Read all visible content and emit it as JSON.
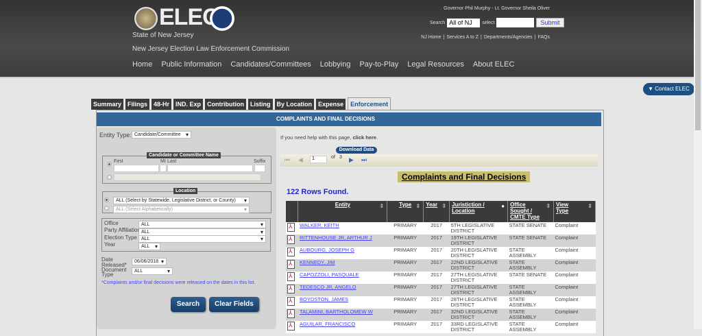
{
  "header": {
    "logo": "ELEC",
    "state": "State of New Jersey",
    "agency": "New Jersey Election Law Enforcement Commission",
    "governor": "Governor Phil Murphy - Lt. Governor Sheila Oliver",
    "search_label": "Search",
    "search_scope": "All of NJ",
    "select_label": "select",
    "submit": "Submit",
    "links": [
      "NJ Home",
      "Services A to Z",
      "Departments/Agencies",
      "FAQs"
    ],
    "nav": [
      "Home",
      "Public Information",
      "Candidates/Committees",
      "Lobbying",
      "Pay-to-Play",
      "Legal Resources",
      "About ELEC"
    ]
  },
  "contact": "▼ Contact ELEC",
  "tabs": [
    "Summary",
    "Filings",
    "48-Hr",
    "IND. Exp",
    "Contribution",
    "Listing",
    "By Location",
    "Expense",
    "Enforcement"
  ],
  "section_title": "COMPLAINTS AND FINAL DECISIONS",
  "form": {
    "entity_type_label": "Entity Type:",
    "entity_type": "Candidate/Committee",
    "name_legend": "Candidate or Committee Name",
    "first": "First",
    "mi": "MI",
    "last": "Last",
    "suffix": "Suffix",
    "location_legend": "Location",
    "loc1": "ALL (Select by Statewide, Legislative District, or County)",
    "loc2": "ALL (Select Alphabetically)",
    "office_label": "Office",
    "office": "ALL",
    "party_label": "Party Affiliation",
    "party": "ALL",
    "election_label": "Election Type",
    "election": "ALL",
    "year_label": "Year",
    "year": "ALL",
    "date_label": "Date Released*",
    "date": "06/06/2018",
    "doc_label": "Document Type",
    "doc": "ALL",
    "note": "*Complaints and/or final decisions were released on the dates in this list.",
    "search": "Search",
    "clear": "Clear Fields"
  },
  "results": {
    "help_prefix": "If you need help with this page,",
    "help_link": "click here",
    "help_suffix": ".",
    "download": "Download Data",
    "page": "1",
    "of": "of",
    "pages": "3",
    "title": "Complaints and Final Decisions",
    "count": "122 Rows Found.",
    "columns": [
      "Entity",
      "Type",
      "Year",
      "Juristiction / Location",
      "Office Sought / CMTE Type",
      "View Type"
    ],
    "rows": [
      [
        "WALKER, KEITH",
        "PRIMARY",
        "2017",
        "5TH LEGISLATIVE DISTRICT",
        "STATE SENATE",
        "Complaint"
      ],
      [
        "RITTENHOUSE JR, ARTHUR J",
        "PRIMARY",
        "2017",
        "19TH LEGISLATIVE DISTRICT",
        "STATE SENATE",
        "Complaint"
      ],
      [
        "AUBOURG, JOSEPH G",
        "PRIMARY",
        "2017",
        "20TH LEGISLATIVE DISTRICT",
        "STATE ASSEMBLY",
        "Complaint"
      ],
      [
        "KENNEDY, JIM",
        "PRIMARY",
        "2017",
        "22ND LEGISLATIVE DISTRICT",
        "STATE ASSEMBLY",
        "Complaint"
      ],
      [
        "CAPOZZOLI, PASQUALE",
        "PRIMARY",
        "2017",
        "27TH LEGISLATIVE DISTRICT",
        "STATE SENATE",
        "Complaint"
      ],
      [
        "TEDESCO JR, ANGELO",
        "PRIMARY",
        "2017",
        "27TH LEGISLATIVE DISTRICT",
        "STATE ASSEMBLY",
        "Complaint"
      ],
      [
        "BOYDSTON, JAMES",
        "PRIMARY",
        "2017",
        "28TH LEGISLATIVE DISTRICT",
        "STATE ASSEMBLY",
        "Complaint"
      ],
      [
        "TALAMINI, BARTHOLOMEW W",
        "PRIMARY",
        "2017",
        "32ND LEGISLATIVE DISTRICT",
        "STATE ASSEMBLY",
        "Complaint"
      ],
      [
        "AGUILAR, FRANCISCO",
        "PRIMARY",
        "2017",
        "33RD LEGISLATIVE DISTRICT",
        "STATE ASSEMBLY",
        "Complaint"
      ]
    ]
  }
}
